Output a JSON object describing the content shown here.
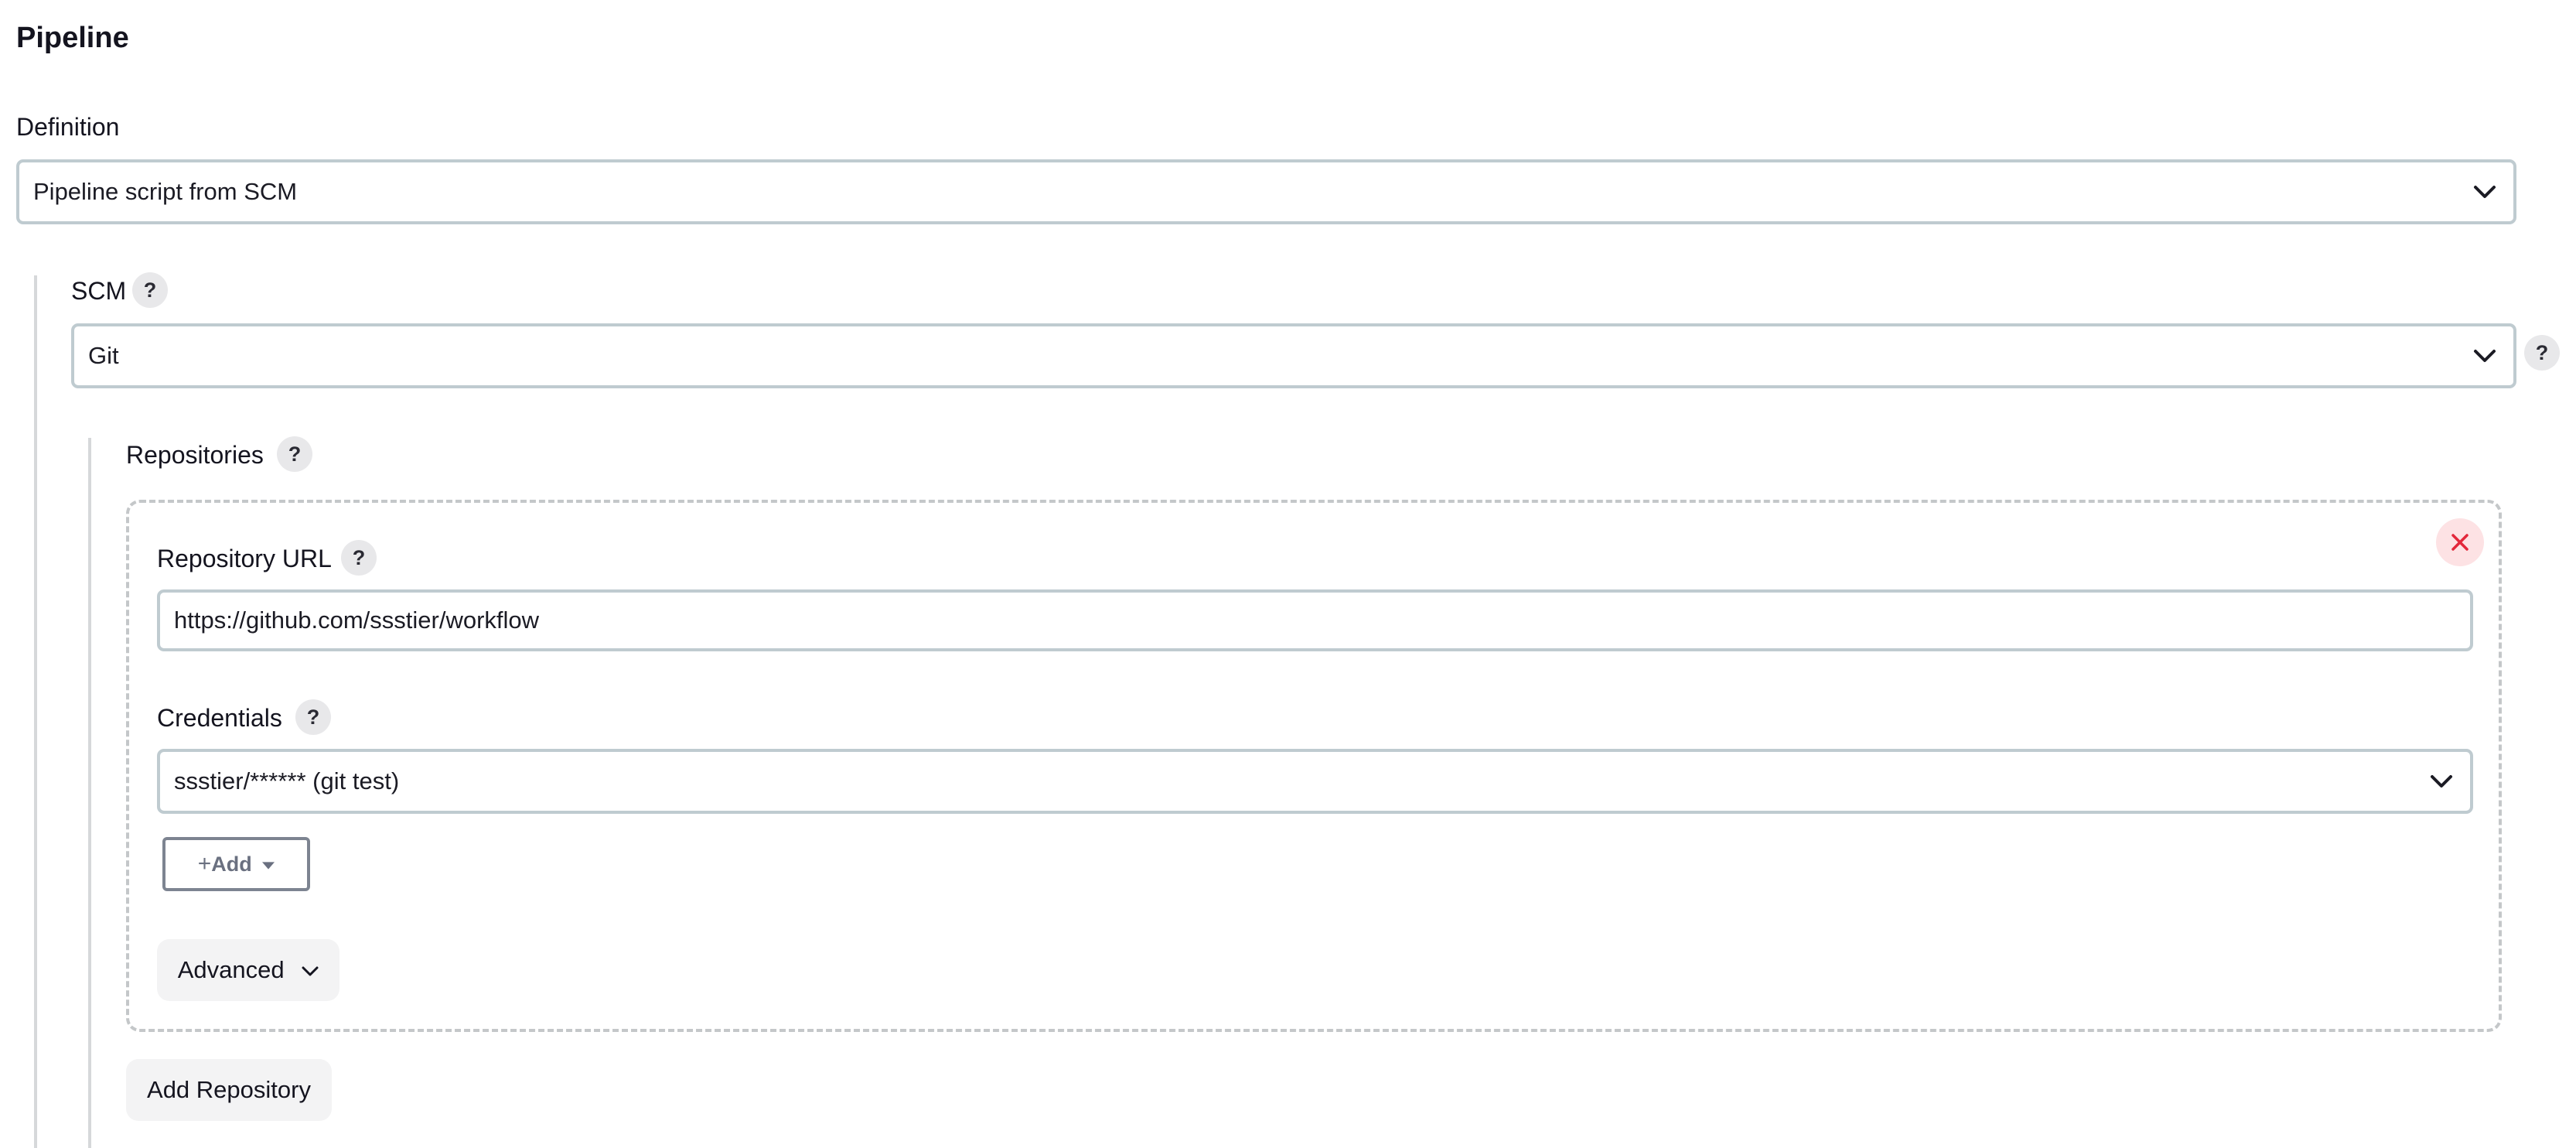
{
  "section": {
    "title": "Pipeline"
  },
  "definition": {
    "label": "Definition",
    "selected": "Pipeline script from SCM"
  },
  "scm": {
    "label": "SCM",
    "help": "?",
    "selected": "Git",
    "side_help": "?"
  },
  "repositories": {
    "label": "Repositories",
    "help": "?",
    "url_label": "Repository URL",
    "url_help": "?",
    "url_value": "https://github.com/ssstier/workflow",
    "credentials_label": "Credentials",
    "credentials_help": "?",
    "credentials_selected": "ssstier/****** (git test)",
    "add_label": "Add",
    "advanced_label": "Advanced",
    "add_repository_label": "Add Repository"
  },
  "colors": {
    "border": "#bfcbd0",
    "help_bg": "#e8e8ea",
    "close_bg": "#fde2e4",
    "close_icon": "#e3283b",
    "soft_button_bg": "#f3f3f4",
    "dashed_border": "#c4c7c9"
  },
  "icons": {
    "select_chevron": "chevron-down-icon",
    "close": "close-icon",
    "add": "plus-icon",
    "add_caret": "caret-down-icon",
    "advanced_chevron": "chevron-down-icon"
  }
}
